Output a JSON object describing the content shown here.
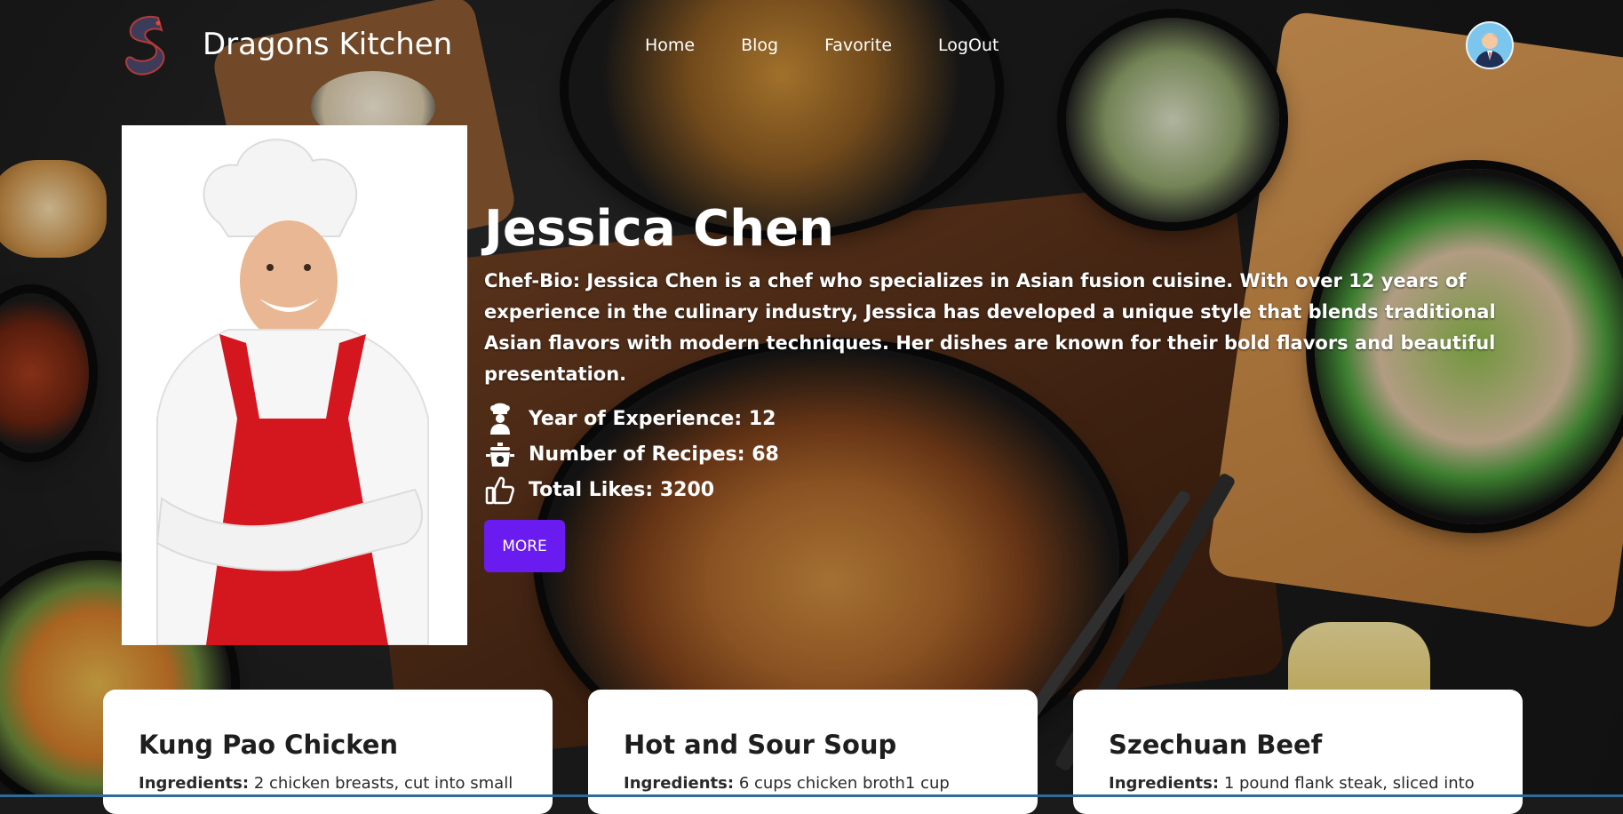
{
  "header": {
    "brand": "Dragons Kitchen",
    "nav": [
      "Home",
      "Blog",
      "Favorite",
      "LogOut"
    ]
  },
  "chef": {
    "name": "Jessica Chen",
    "bio": "Chef-Bio: Jessica Chen is a chef who specializes in Asian fusion cuisine. With over 12 years of experience in the culinary industry, Jessica has developed a unique style that blends traditional Asian flavors with modern techniques. Her dishes are known for their bold flavors and beautiful presentation.",
    "stats": [
      {
        "icon": "chef-icon",
        "label": "Year of Experience:",
        "value": "12"
      },
      {
        "icon": "cooking-pot-icon",
        "label": "Number of Recipes:",
        "value": "68"
      },
      {
        "icon": "thumbs-up-icon",
        "label": "Total Likes:",
        "value": "3200"
      }
    ],
    "more_label": "MORE"
  },
  "recipes": [
    {
      "title": "Kung Pao Chicken",
      "ingredients_label": "Ingredients:",
      "ingredients": "2 chicken breasts, cut into small"
    },
    {
      "title": "Hot and Sour Soup",
      "ingredients_label": "Ingredients:",
      "ingredients": "6 cups chicken broth1 cup"
    },
    {
      "title": "Szechuan Beef",
      "ingredients_label": "Ingredients:",
      "ingredients": "1 pound flank steak, sliced into"
    }
  ],
  "colors": {
    "accent": "#6a1bef",
    "text_light": "#ffffff",
    "card_bg": "#ffffff"
  }
}
